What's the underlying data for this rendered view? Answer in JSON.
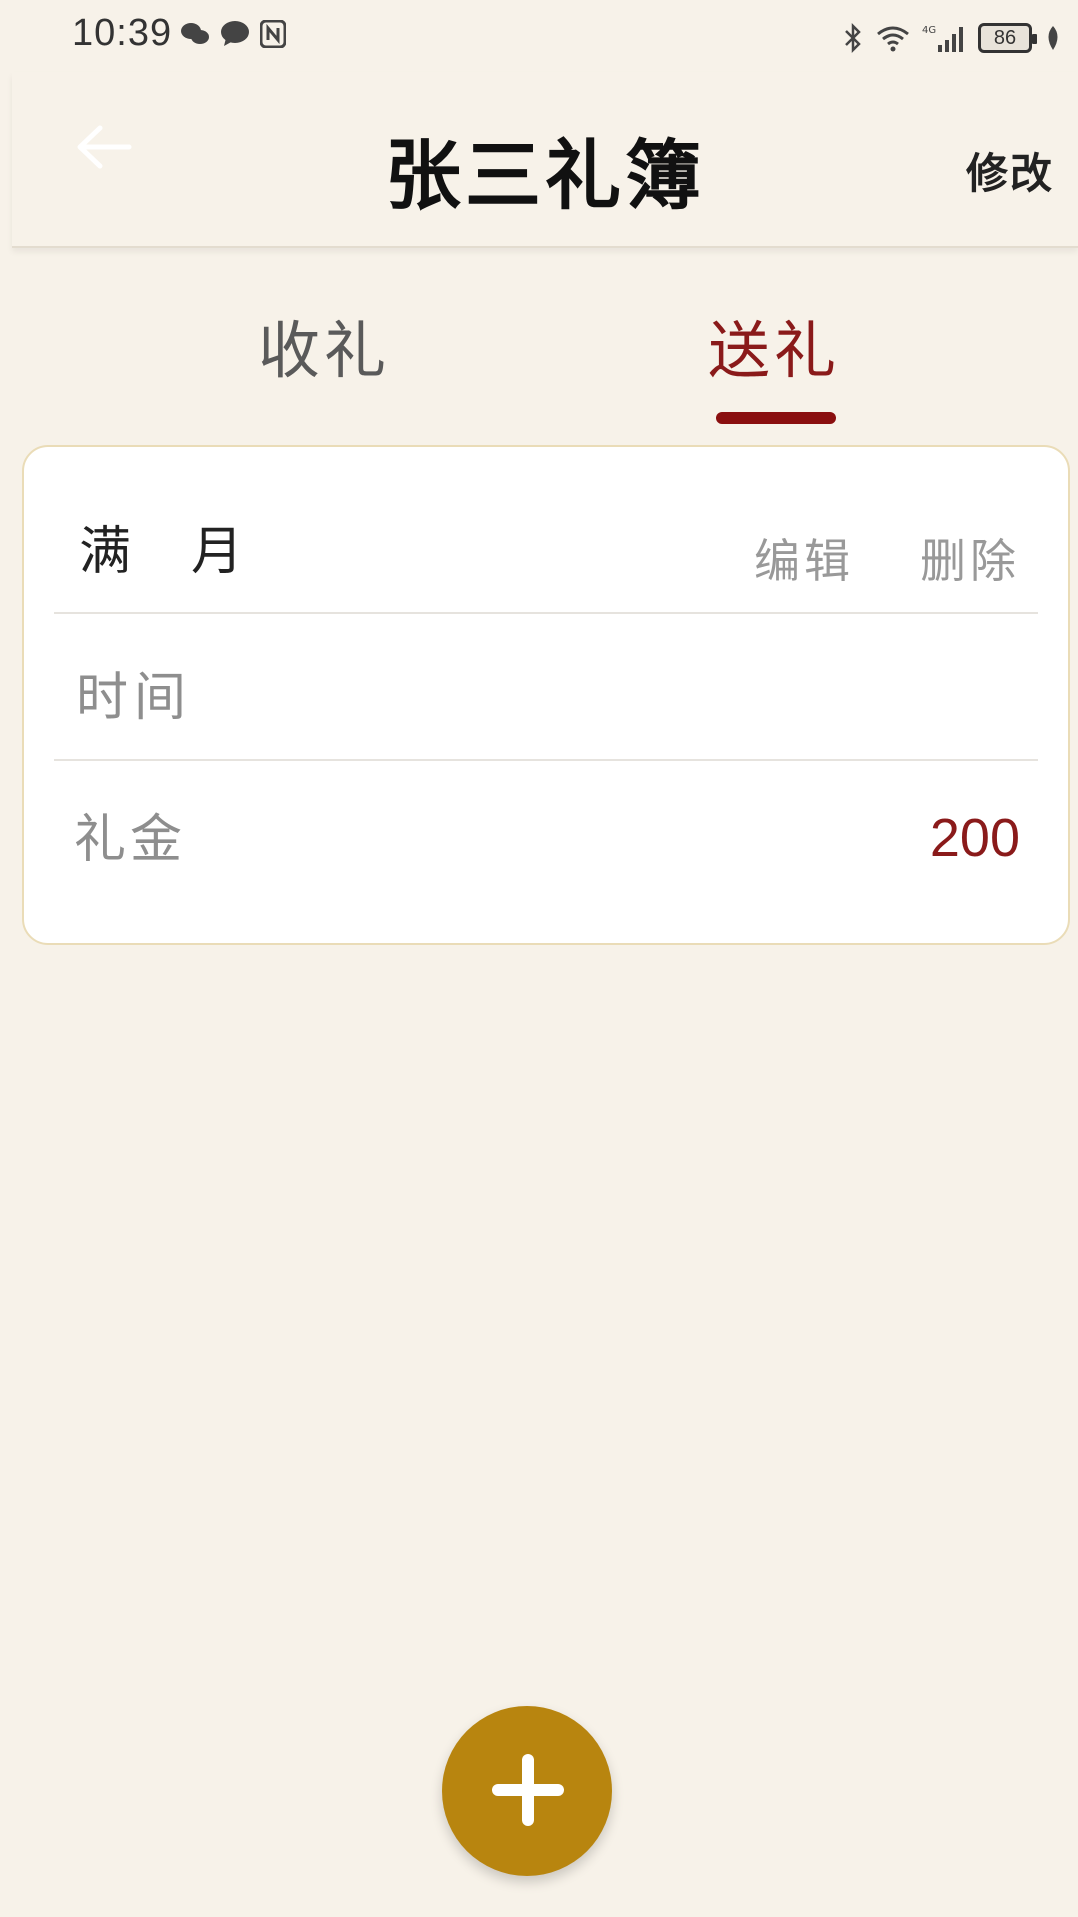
{
  "status_bar": {
    "time": "10:39",
    "battery": "86",
    "left_icons": [
      "wechat-icon",
      "message-icon",
      "nfc-icon"
    ],
    "right_icons": [
      "bluetooth-icon",
      "wifi-icon",
      "signal-4g-icon",
      "battery-icon",
      "leaf-icon"
    ]
  },
  "header": {
    "title": "张三礼簿",
    "edit_label": "修改",
    "back_icon": "arrow-left-icon"
  },
  "tabs": [
    {
      "label": "收礼",
      "active": false
    },
    {
      "label": "送礼",
      "active": true
    }
  ],
  "record": {
    "event": "满月",
    "edit_label": "编辑",
    "delete_label": "删除",
    "time_label": "时间",
    "time_value": "",
    "money_label": "礼金",
    "amount": "200"
  },
  "fab": {
    "icon": "plus-icon"
  },
  "colors": {
    "background": "#f7f2e9",
    "accent_red": "#8a1a1a",
    "fab": "#b8850f",
    "card_border": "#eadcb7"
  }
}
